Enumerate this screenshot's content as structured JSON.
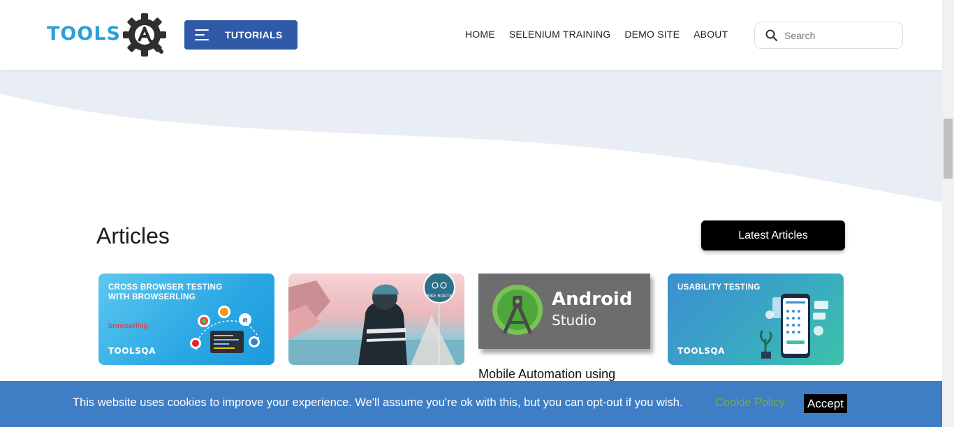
{
  "header": {
    "logo_text": "TOOLS",
    "tutorials_label": "TUTORIALS",
    "nav": [
      {
        "label": "HOME"
      },
      {
        "label": "SELENIUM TRAINING"
      },
      {
        "label": "DEMO SITE"
      },
      {
        "label": "ABOUT"
      }
    ],
    "search_placeholder": "Search"
  },
  "articles": {
    "title": "Articles",
    "latest_label": "Latest Articles",
    "cards": [
      {
        "heading": "CROSS BROWSER TESTING\nWITH BROWSERLING",
        "brand": "browserling",
        "logo": "TOOLSQA"
      },
      {
        "sign": "BIKE ROUTE"
      },
      {
        "title": "Android",
        "subtitle": "Studio",
        "caption": "Mobile Automation using"
      },
      {
        "heading": "USABILITY TESTING",
        "logo": "TOOLSQA"
      }
    ]
  },
  "cookie": {
    "message": "This website uses cookies to improve your experience. We'll assume you're ok with this, but you can opt-out if you wish.",
    "policy_label": "Cookie Policy",
    "accept_label": "Accept"
  },
  "colors": {
    "primary": "#2e5aa7",
    "logo_blue": "#2a9fd8",
    "cookie_bar": "#3f7ec4",
    "cookie_link": "#6fae4a",
    "wave": "#e9edf4"
  }
}
